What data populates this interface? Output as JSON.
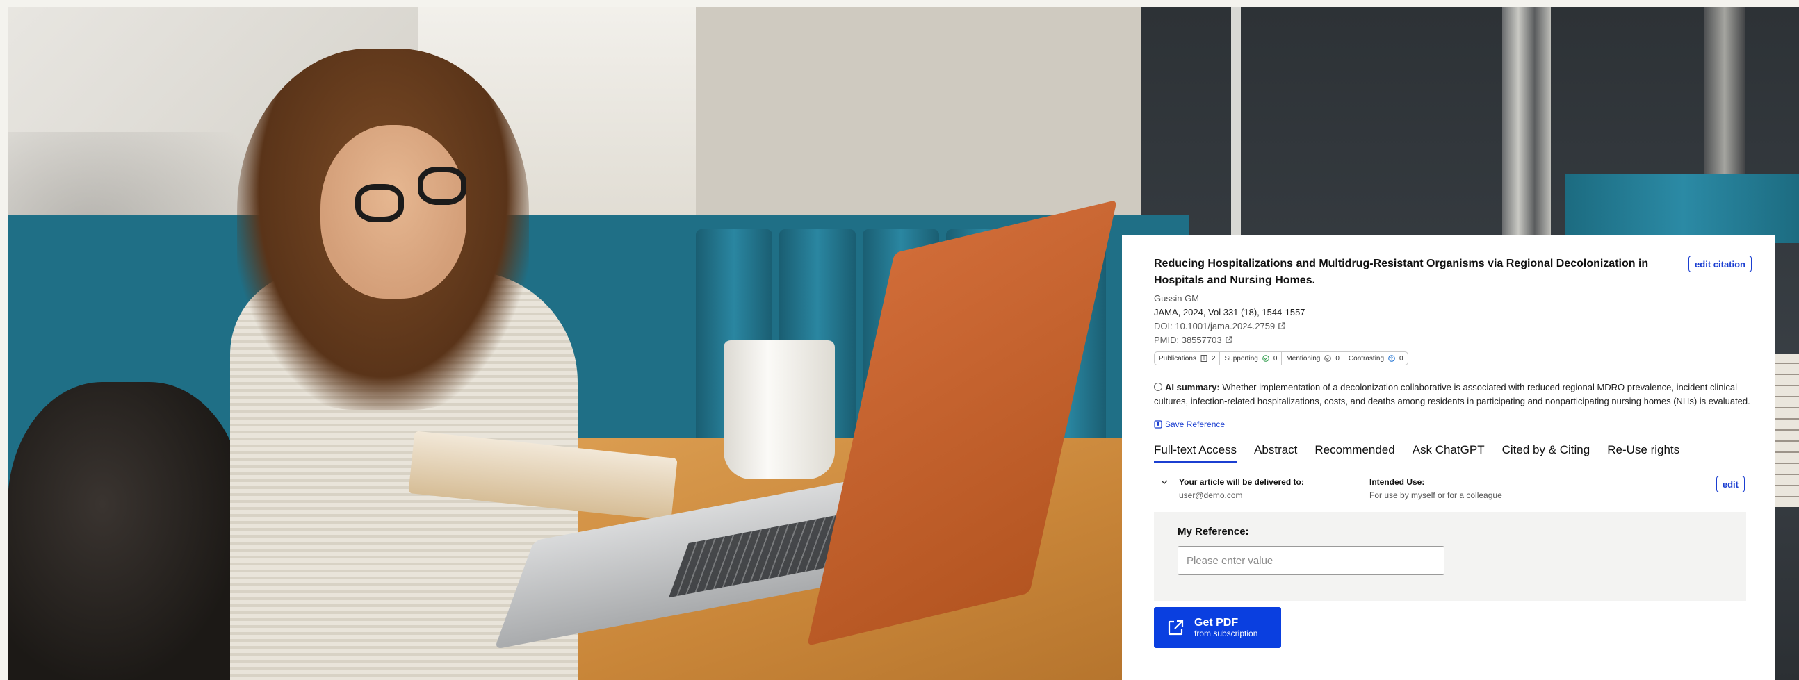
{
  "article": {
    "title": "Reducing Hospitalizations and Multidrug-Resistant Organisms via Regional Decolonization in Hospitals and Nursing Homes.",
    "edit_citation_label": "edit citation",
    "author": "Gussin GM",
    "journal": "JAMA, 2024, Vol 331 (18), 1544-1557",
    "doi": "DOI: 10.1001/jama.2024.2759",
    "pmid": "PMID: 38557703"
  },
  "badges": [
    {
      "label": "Publications",
      "icon": "document-icon",
      "count": "2"
    },
    {
      "label": "Supporting",
      "icon": "check-circle-icon",
      "count": "0"
    },
    {
      "label": "Mentioning",
      "icon": "check-circle-icon",
      "count": "0"
    },
    {
      "label": "Contrasting",
      "icon": "question-circle-icon",
      "count": "0"
    }
  ],
  "ai_summary": {
    "label": "AI summary:",
    "text": "Whether implementation of a decolonization collaborative is associated with reduced regional MDRO prevalence, incident clinical cultures, infection-related hospitalizations, costs, and deaths among residents in participating and nonparticipating nursing homes (NHs) is evaluated."
  },
  "save_reference_label": "Save Reference",
  "tabs": [
    {
      "label": "Full-text Access",
      "active": true
    },
    {
      "label": "Abstract"
    },
    {
      "label": "Recommended"
    },
    {
      "label": "Ask ChatGPT"
    },
    {
      "label": "Cited by & Citing"
    },
    {
      "label": "Re-Use rights"
    }
  ],
  "delivery": {
    "delivered_label": "Your article will be delivered to:",
    "delivered_value": "user@demo.com",
    "intended_label": "Intended Use:",
    "intended_value": "For use by myself or for a colleague",
    "edit_label": "edit"
  },
  "reference": {
    "label": "My Reference:",
    "placeholder": "Please enter value",
    "value": ""
  },
  "get_pdf": {
    "label": "Get PDF",
    "sublabel": "from subscription"
  },
  "colors": {
    "accent": "#1b3fd1",
    "button_bg": "#0a3fe0",
    "page_bg": "#f4f3ee"
  }
}
